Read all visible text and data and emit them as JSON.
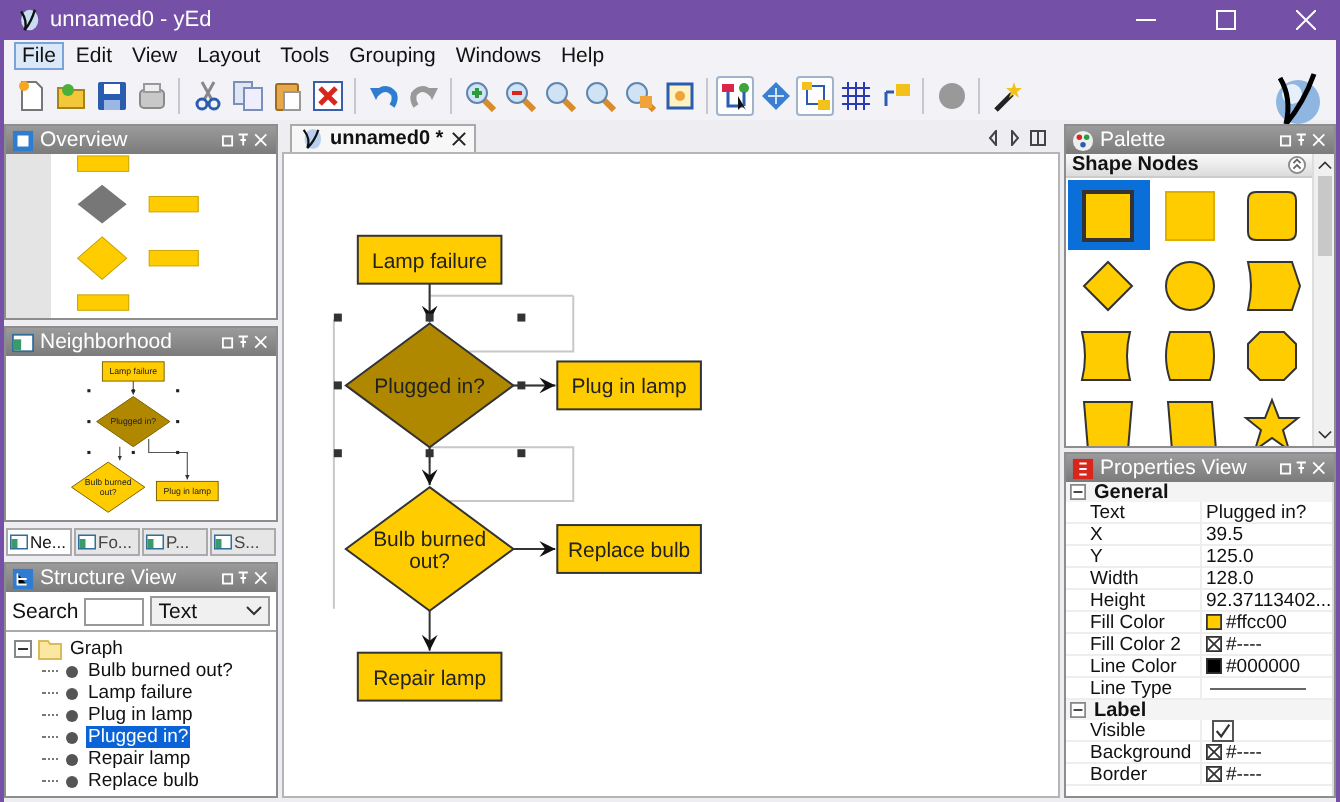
{
  "window": {
    "title": "unnamed0 - yEd"
  },
  "menu": [
    {
      "label": "File",
      "selected": true
    },
    {
      "label": "Edit",
      "selected": false
    },
    {
      "label": "View",
      "selected": false
    },
    {
      "label": "Layout",
      "selected": false
    },
    {
      "label": "Tools",
      "selected": false
    },
    {
      "label": "Grouping",
      "selected": false
    },
    {
      "label": "Windows",
      "selected": false
    },
    {
      "label": "Help",
      "selected": false
    }
  ],
  "toolbar": [
    [
      {
        "kind": "new",
        "pressed": false
      },
      {
        "kind": "open",
        "pressed": false
      },
      {
        "kind": "save",
        "pressed": false
      },
      {
        "kind": "print",
        "pressed": false
      }
    ],
    [
      {
        "kind": "cut",
        "pressed": false
      },
      {
        "kind": "copy",
        "pressed": false
      },
      {
        "kind": "paste",
        "pressed": false
      },
      {
        "kind": "delete",
        "pressed": false
      }
    ],
    [
      {
        "kind": "undo",
        "pressed": false
      },
      {
        "kind": "redo",
        "pressed": false
      }
    ],
    [
      {
        "kind": "zoom-in",
        "pressed": false
      },
      {
        "kind": "zoom-out",
        "pressed": false
      },
      {
        "kind": "zoom-reset",
        "pressed": false
      },
      {
        "kind": "zoom",
        "pressed": false
      },
      {
        "kind": "zoom-area",
        "pressed": false
      },
      {
        "kind": "fit",
        "pressed": false
      }
    ],
    [
      {
        "kind": "select",
        "pressed": true
      },
      {
        "kind": "diamond",
        "pressed": false
      },
      {
        "kind": "orthogonal",
        "pressed": true
      },
      {
        "kind": "grid",
        "pressed": false
      },
      {
        "kind": "port",
        "pressed": false
      }
    ],
    [
      {
        "kind": "blob",
        "pressed": false
      }
    ],
    [
      {
        "kind": "wand",
        "pressed": false
      }
    ]
  ],
  "overview": {
    "title": "Overview"
  },
  "neighborhood": {
    "title": "Neighborhood",
    "nodes": [
      {
        "lines": [
          "Lamp failure"
        ],
        "selected": false
      },
      {
        "lines": [
          "Plugged in?"
        ],
        "selected": true
      },
      {
        "lines": [
          "Bulb burned",
          "out?"
        ],
        "selected": false
      },
      {
        "lines": [
          "Plug in lamp"
        ],
        "selected": false
      }
    ]
  },
  "left_tabs": [
    {
      "label": "Ne...",
      "selected": true
    },
    {
      "label": "Fo...",
      "selected": false
    },
    {
      "label": "P...",
      "selected": false
    },
    {
      "label": "S...",
      "selected": false
    }
  ],
  "structure": {
    "title": "Structure View",
    "search_label": "Search",
    "filter": "Text",
    "root": {
      "label": "Graph",
      "expanded": true,
      "children": [
        {
          "label": "Bulb burned out?",
          "selected": false
        },
        {
          "label": "Lamp failure",
          "selected": false
        },
        {
          "label": "Plug in lamp",
          "selected": false
        },
        {
          "label": "Plugged in?",
          "selected": true
        },
        {
          "label": "Repair lamp",
          "selected": false
        },
        {
          "label": "Replace bulb",
          "selected": false
        }
      ]
    }
  },
  "document_tab": {
    "label": "unnamed0 *",
    "selected": true
  },
  "diagram": {
    "nodes": [
      {
        "kind": "rect",
        "lines": [
          "Lamp failure"
        ],
        "selected": false
      },
      {
        "kind": "diamond",
        "lines": [
          "Plugged in?"
        ],
        "selected": true
      },
      {
        "kind": "rect",
        "lines": [
          "Plug in lamp"
        ],
        "selected": false
      },
      {
        "kind": "diamond",
        "lines": [
          "Bulb burned",
          "out?"
        ],
        "selected": false
      },
      {
        "kind": "rect",
        "lines": [
          "Replace bulb"
        ],
        "selected": false
      },
      {
        "kind": "rect",
        "lines": [
          "Repair lamp"
        ],
        "selected": false
      }
    ]
  },
  "palette": {
    "title": "Palette",
    "section": "Shape Nodes",
    "shapes": [
      {
        "kind": "rectangle",
        "selected": true
      },
      {
        "kind": "flat-rectangle",
        "selected": false
      },
      {
        "kind": "rounded-rectangle",
        "selected": false
      },
      {
        "kind": "diamond",
        "selected": false
      },
      {
        "kind": "ellipse",
        "selected": false
      },
      {
        "kind": "wave-right",
        "selected": false
      },
      {
        "kind": "wave-both",
        "selected": false
      },
      {
        "kind": "barrel",
        "selected": false
      },
      {
        "kind": "octagon",
        "selected": false
      },
      {
        "kind": "trapezoid",
        "selected": false
      },
      {
        "kind": "parallelogram",
        "selected": false
      },
      {
        "kind": "star",
        "selected": false
      }
    ]
  },
  "properties": {
    "title": "Properties View",
    "sections": [
      {
        "label": "General",
        "expanded": true,
        "rows": [
          {
            "kind": "text",
            "name": "Text",
            "value": "Plugged in?"
          },
          {
            "kind": "text",
            "name": "X",
            "value": "39.5"
          },
          {
            "kind": "text",
            "name": "Y",
            "value": "125.0"
          },
          {
            "kind": "text",
            "name": "Width",
            "value": "128.0"
          },
          {
            "kind": "text",
            "name": "Height",
            "value": "92.37113402..."
          },
          {
            "kind": "color",
            "name": "Fill Color",
            "value": "#ffcc00",
            "color": "#ffcc00"
          },
          {
            "kind": "none",
            "name": "Fill Color 2",
            "value": "#----"
          },
          {
            "kind": "color",
            "name": "Line Color",
            "value": "#000000",
            "color": "#000000"
          },
          {
            "kind": "line",
            "name": "Line Type"
          }
        ]
      },
      {
        "label": "Label",
        "expanded": true,
        "rows": [
          {
            "kind": "check",
            "name": "Visible",
            "checked": true
          },
          {
            "kind": "none",
            "name": "Background",
            "value": "#----"
          },
          {
            "kind": "none",
            "name": "Border",
            "value": "#----"
          }
        ]
      }
    ]
  }
}
